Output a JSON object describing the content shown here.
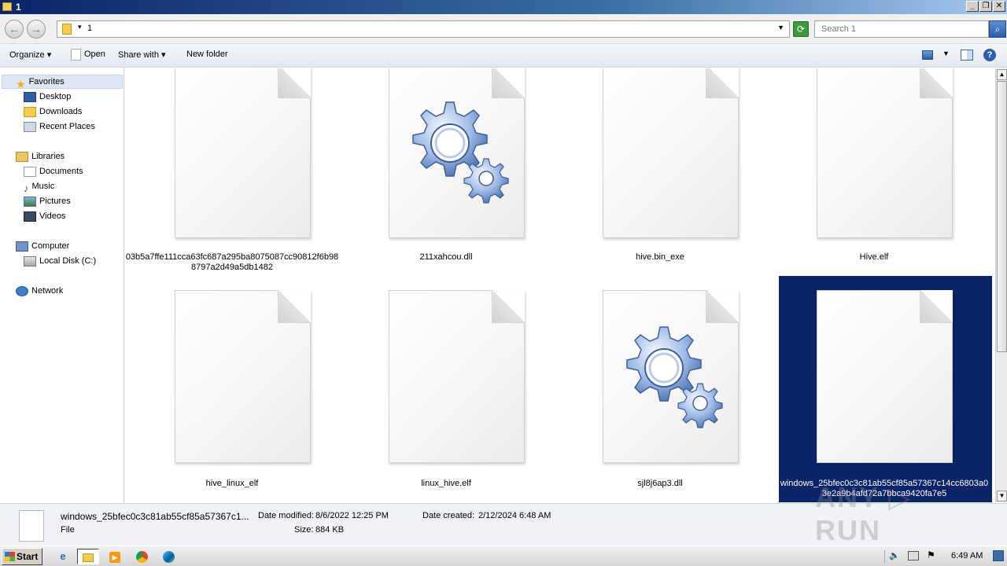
{
  "window": {
    "title": "1"
  },
  "address": {
    "crumb": "1",
    "search_placeholder": "Search 1"
  },
  "toolbar": {
    "organize": "Organize",
    "open": "Open",
    "share_with": "Share with",
    "new_folder": "New folder"
  },
  "nav": {
    "favorites": "Favorites",
    "desktop": "Desktop",
    "downloads": "Downloads",
    "recent_places": "Recent Places",
    "libraries": "Libraries",
    "documents": "Documents",
    "music": "Music",
    "pictures": "Pictures",
    "videos": "Videos",
    "computer": "Computer",
    "local_disk": "Local Disk (C:)",
    "network": "Network"
  },
  "files": [
    {
      "name": "03b5a7ffe111cca63fc687a295ba8075087cc90812f6b988797a2d49a5db1482",
      "icon": "generic-file-icon"
    },
    {
      "name": "211xahcou.dll",
      "icon": "dll-gears-icon"
    },
    {
      "name": "hive.bin_exe",
      "icon": "generic-file-icon"
    },
    {
      "name": "Hive.elf",
      "icon": "generic-file-icon"
    },
    {
      "name": "hive_linux_elf",
      "icon": "generic-file-icon"
    },
    {
      "name": "linux_hive.elf",
      "icon": "generic-file-icon"
    },
    {
      "name": "sjl8j6ap3.dll",
      "icon": "dll-gears-icon"
    },
    {
      "name": "windows_25bfec0c3c81ab55cf85a57367c14cc6803a03e2a9b4afd72a7bbca9420fa7e5",
      "icon": "generic-file-icon",
      "selected": true
    }
  ],
  "details": {
    "name": "windows_25bfec0c3c81ab55cf85a57367c1...",
    "type": "File",
    "date_modified_label": "Date modified:",
    "date_modified": "8/6/2022 12:25 PM",
    "size_label": "Size:",
    "size": "884 KB",
    "date_created_label": "Date created:",
    "date_created": "2/12/2024 6:48 AM"
  },
  "watermark": "ANY RUN",
  "taskbar": {
    "start": "Start",
    "clock": "6:49 AM"
  },
  "colors": {
    "selection": "#0a246a",
    "titlebar": "#0a246a"
  }
}
